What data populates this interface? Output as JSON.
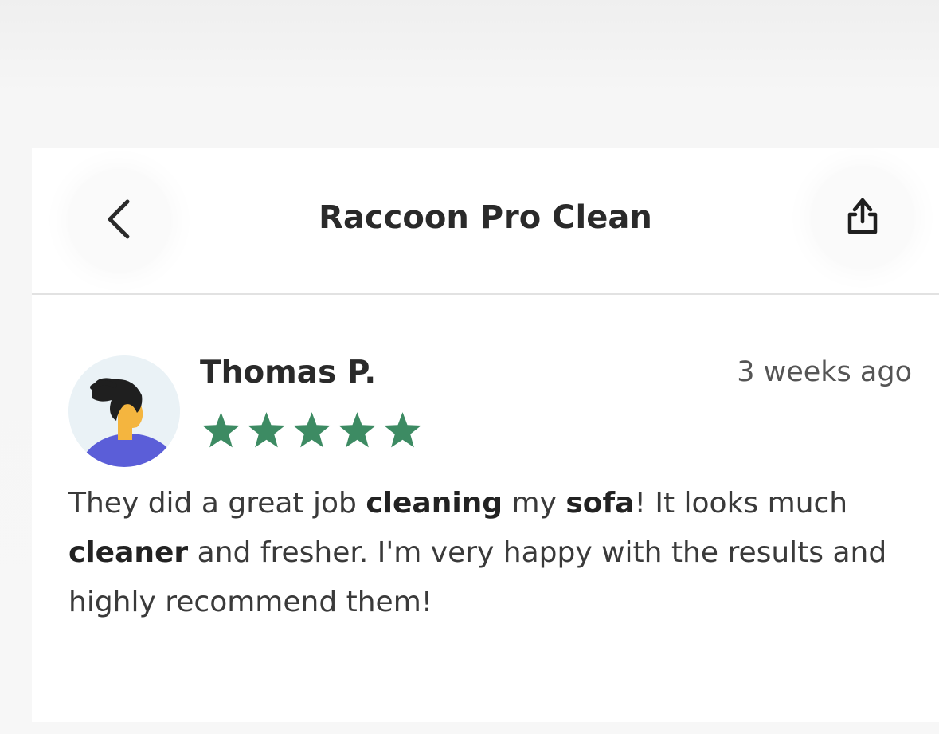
{
  "header": {
    "title": "Raccoon Pro Clean",
    "back_icon": "chevron-left-icon",
    "share_icon": "share-icon"
  },
  "review": {
    "author": "Thomas P.",
    "time": "3 weeks ago",
    "rating": 5,
    "rating_max": 5,
    "star_color": "#3d8b63",
    "avatar_icon": "avatar-illustration",
    "text_segments": [
      {
        "text": "They did a great job ",
        "bold": false
      },
      {
        "text": "cleaning",
        "bold": true
      },
      {
        "text": " my ",
        "bold": false
      },
      {
        "text": "sofa",
        "bold": true
      },
      {
        "text": "! It looks much ",
        "bold": false
      },
      {
        "text": "cleaner",
        "bold": true
      },
      {
        "text": " and fresher. I'm very happy with the results and highly recommend them!",
        "bold": false
      }
    ]
  }
}
